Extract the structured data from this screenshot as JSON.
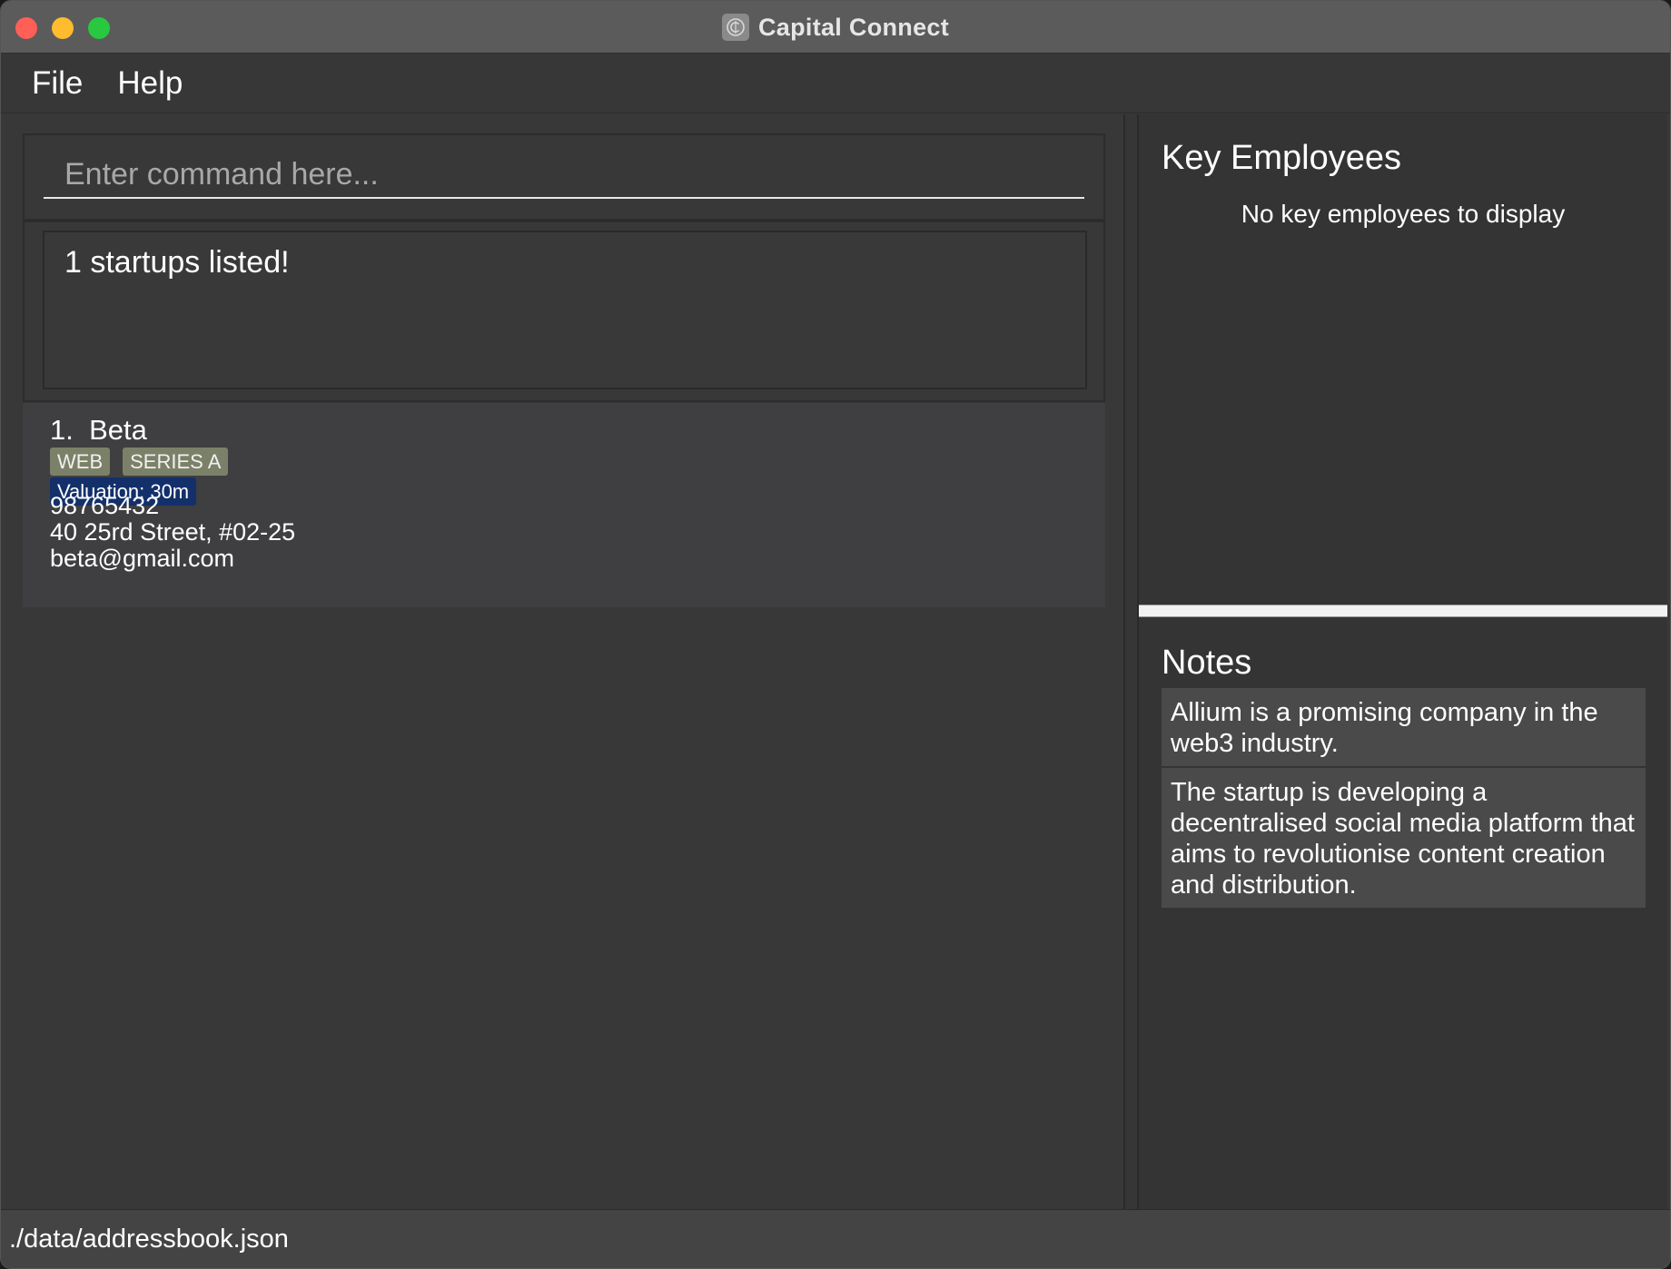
{
  "window": {
    "title": "Capital Connect",
    "icon": "capital-connect-logo-icon"
  },
  "menu": {
    "items": [
      {
        "label": "File"
      },
      {
        "label": "Help"
      }
    ]
  },
  "command": {
    "placeholder": "Enter command here...",
    "value": ""
  },
  "result": {
    "message": "1 startups listed!"
  },
  "startups": [
    {
      "index": "1.",
      "name": "Beta",
      "tags": [
        "WEB",
        "SERIES A"
      ],
      "valuation": "Valuation: 30m",
      "phone": "98765432",
      "address": "40 25rd Street, #02-25",
      "email": "beta@gmail.com"
    }
  ],
  "key_employees": {
    "heading": "Key Employees",
    "empty_message": "No key employees to display"
  },
  "notes": {
    "heading": "Notes",
    "items": [
      "Allium is a promising company in the web3 industry.",
      "The startup is developing a decentralised social media platform that aims to revolutionise content creation and distribution."
    ]
  },
  "status": {
    "path": "./data/addressbook.json"
  },
  "colors": {
    "tag_bg": "#7b8168",
    "valuation_bg": "#13306a",
    "window_bg": "#393939",
    "note_bg": "#4a4a4a"
  }
}
